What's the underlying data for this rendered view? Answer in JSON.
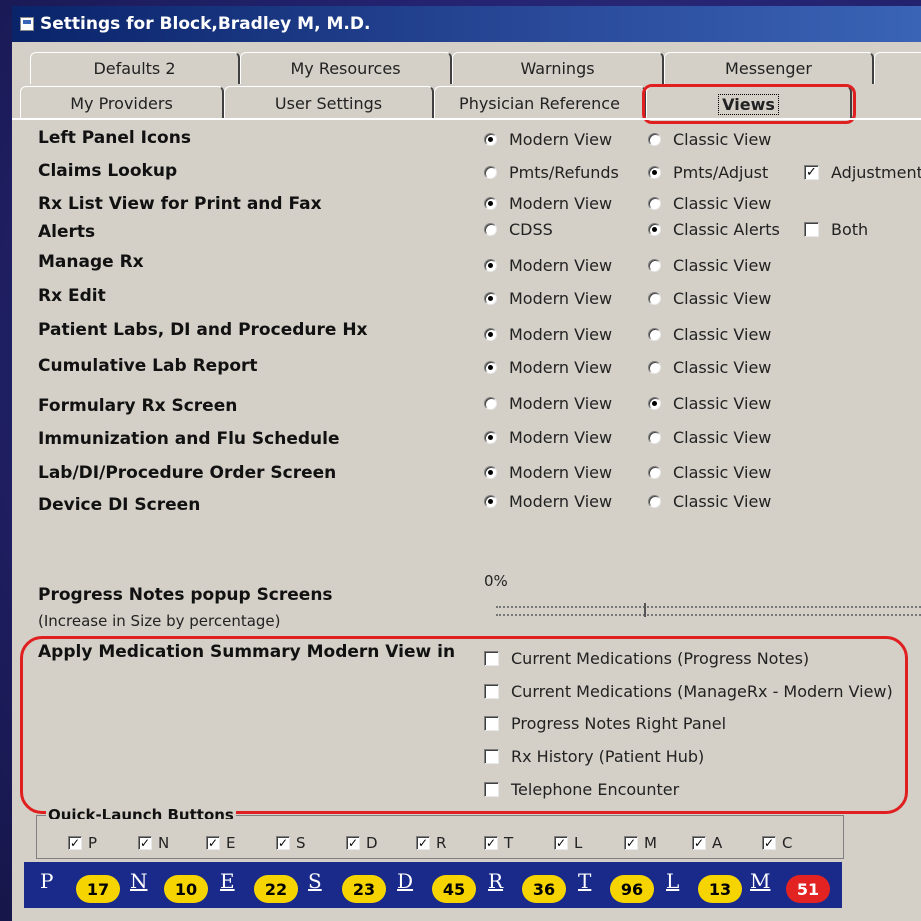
{
  "window": {
    "title": "Settings for Block,Bradley M, M.D."
  },
  "tabs_row1": [
    "Defaults 2",
    "My Resources",
    "Warnings",
    "Messenger",
    ""
  ],
  "tabs_row2": [
    "My Providers",
    "User Settings",
    "Physician Reference",
    "Views"
  ],
  "active_tab": "Views",
  "settings": [
    {
      "label": "Left Panel Icons",
      "options": [
        "Modern View",
        "Classic View"
      ],
      "selected": 0
    },
    {
      "label": "Claims Lookup",
      "options": [
        "Pmts/Refunds",
        "Pmts/Adjust"
      ],
      "selected": 1,
      "checkbox": {
        "label": "Adjustment",
        "checked": true
      }
    },
    {
      "label": "Rx List View for Print and Fax",
      "options": [
        "Modern View",
        "Classic View"
      ],
      "selected": 0
    },
    {
      "label": "Alerts",
      "options": [
        "CDSS",
        "Classic Alerts"
      ],
      "selected": 1,
      "checkbox": {
        "label": "Both",
        "checked": false
      }
    },
    {
      "label": "Manage Rx",
      "options": [
        "Modern View",
        "Classic View"
      ],
      "selected": 0
    },
    {
      "label": "Rx Edit",
      "options": [
        "Modern View",
        "Classic View"
      ],
      "selected": 0
    },
    {
      "label": "Patient Labs, DI and Procedure Hx",
      "options": [
        "Modern View",
        "Classic View"
      ],
      "selected": 0
    },
    {
      "label": "Cumulative Lab Report",
      "options": [
        "Modern View",
        "Classic View"
      ],
      "selected": 0
    },
    {
      "label": "Formulary Rx Screen",
      "options": [
        "Modern View",
        "Classic View"
      ],
      "selected": 1
    },
    {
      "label": "Immunization and Flu Schedule",
      "options": [
        "Modern View",
        "Classic View"
      ],
      "selected": 0
    },
    {
      "label": "Lab/DI/Procedure Order Screen",
      "options": [
        "Modern View",
        "Classic View"
      ],
      "selected": 0
    },
    {
      "label": "Device DI Screen",
      "options": [
        "Modern View",
        "Classic View"
      ],
      "selected": 0
    }
  ],
  "progress_notes": {
    "label": "Progress Notes popup Screens",
    "sublabel": "(Increase in Size by percentage)",
    "value_text": "0%",
    "value": 0
  },
  "med_summary": {
    "label": "Apply Medication Summary Modern View in",
    "items": [
      {
        "label": "Current Medications (Progress Notes)",
        "checked": false
      },
      {
        "label": "Current Medications (ManageRx - Modern View)",
        "checked": false
      },
      {
        "label": "Progress Notes Right Panel",
        "checked": false
      },
      {
        "label": "Rx History (Patient Hub)",
        "checked": false
      },
      {
        "label": "Telephone Encounter",
        "checked": false
      }
    ]
  },
  "quick_launch": {
    "title": "Quick-Launch Buttons",
    "checks": [
      {
        "label": "P",
        "checked": true
      },
      {
        "label": "N",
        "checked": true
      },
      {
        "label": "E",
        "checked": true
      },
      {
        "label": "S",
        "checked": true
      },
      {
        "label": "D",
        "checked": true
      },
      {
        "label": "R",
        "checked": true
      },
      {
        "label": "T",
        "checked": true
      },
      {
        "label": "L",
        "checked": true
      },
      {
        "label": "M",
        "checked": true
      },
      {
        "label": "A",
        "checked": true
      },
      {
        "label": "C",
        "checked": true
      }
    ],
    "buttons": [
      {
        "letter": "P",
        "count": "17"
      },
      {
        "letter": "N",
        "count": "10"
      },
      {
        "letter": "E",
        "count": "22"
      },
      {
        "letter": "S",
        "count": "23"
      },
      {
        "letter": "D",
        "count": "45"
      },
      {
        "letter": "R",
        "count": "36"
      },
      {
        "letter": "T",
        "count": "96"
      },
      {
        "letter": "L",
        "count": "13"
      },
      {
        "letter": "M",
        "count": "51"
      }
    ]
  },
  "colors": {
    "highlight": "#e02020",
    "badge": "#f6d400",
    "badge_alert": "#e32222",
    "bar": "#1a2a8a"
  }
}
